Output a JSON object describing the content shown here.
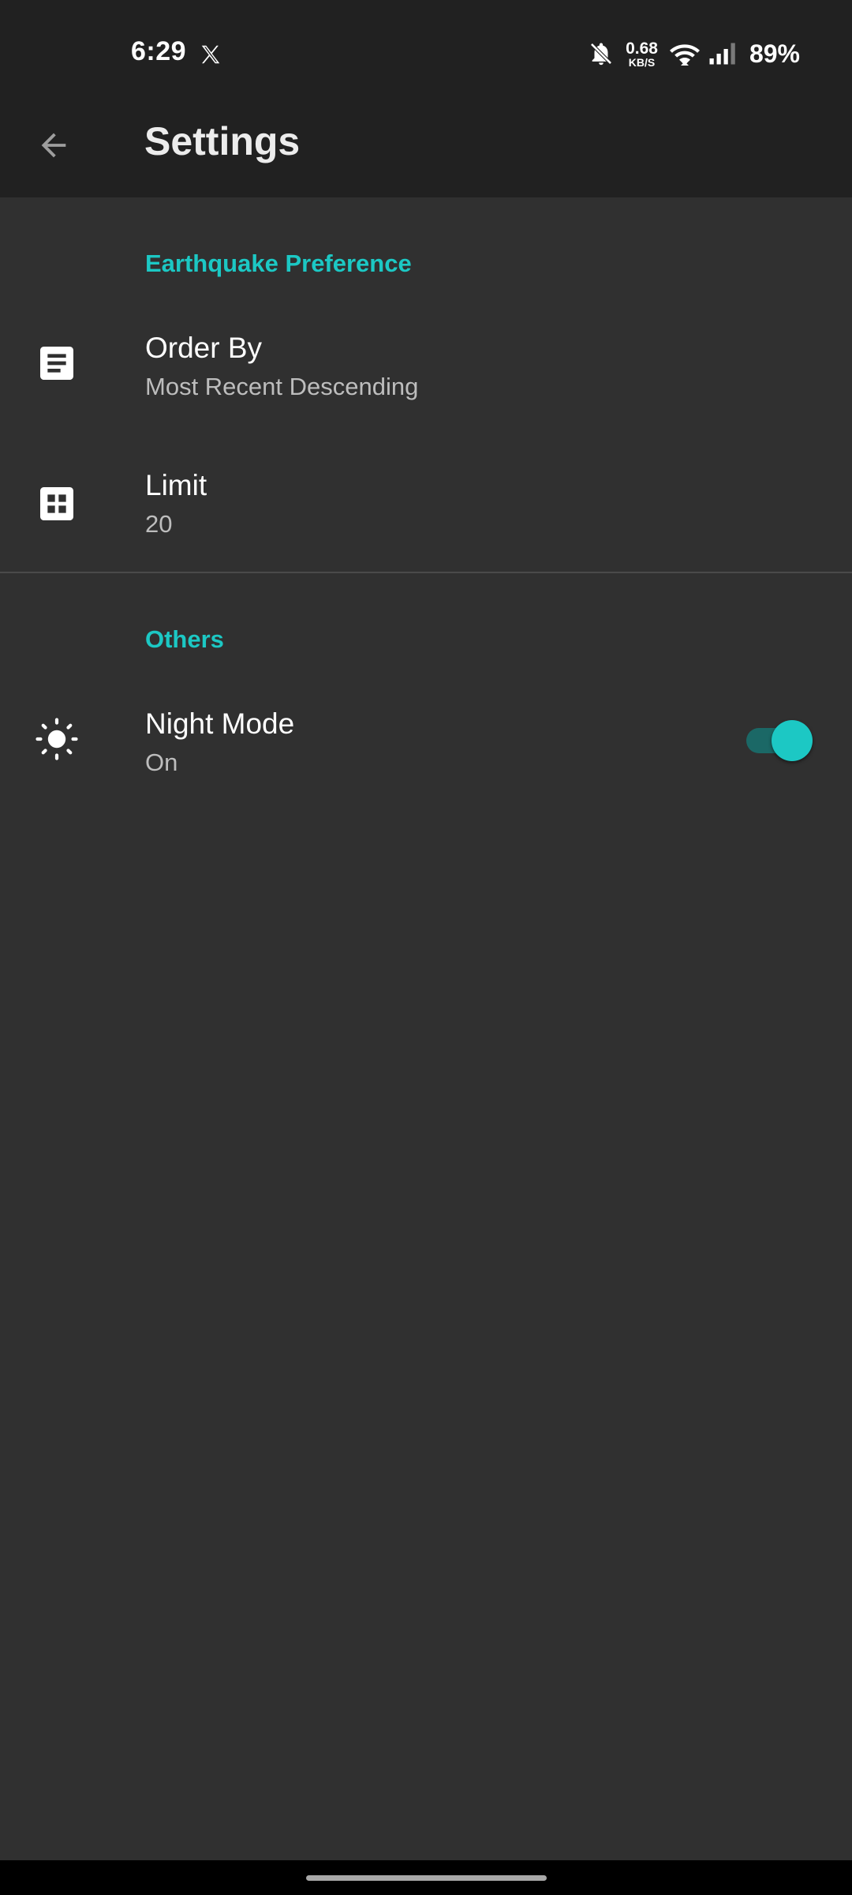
{
  "status_bar": {
    "time": "6:29",
    "network_speed_value": "0.68",
    "network_speed_unit": "KB/S",
    "battery": "89%",
    "icons": [
      "x-logo-icon",
      "bell-muted-icon",
      "wifi-icon",
      "signal-icon"
    ]
  },
  "app_bar": {
    "title": "Settings",
    "back_icon": "arrow-back-icon"
  },
  "sections": [
    {
      "header": "Earthquake Preference",
      "items": [
        {
          "title": "Order By",
          "summary": "Most Recent Descending",
          "icon": "document-icon"
        },
        {
          "title": "Limit",
          "summary": "20",
          "icon": "grid-icon"
        }
      ]
    },
    {
      "header": "Others",
      "items": [
        {
          "title": "Night Mode",
          "summary": "On",
          "icon": "brightness-icon",
          "toggle_on": true
        }
      ]
    }
  ],
  "colors": {
    "accent": "#1cc8c4",
    "background": "#303030",
    "app_bar": "#212121"
  }
}
